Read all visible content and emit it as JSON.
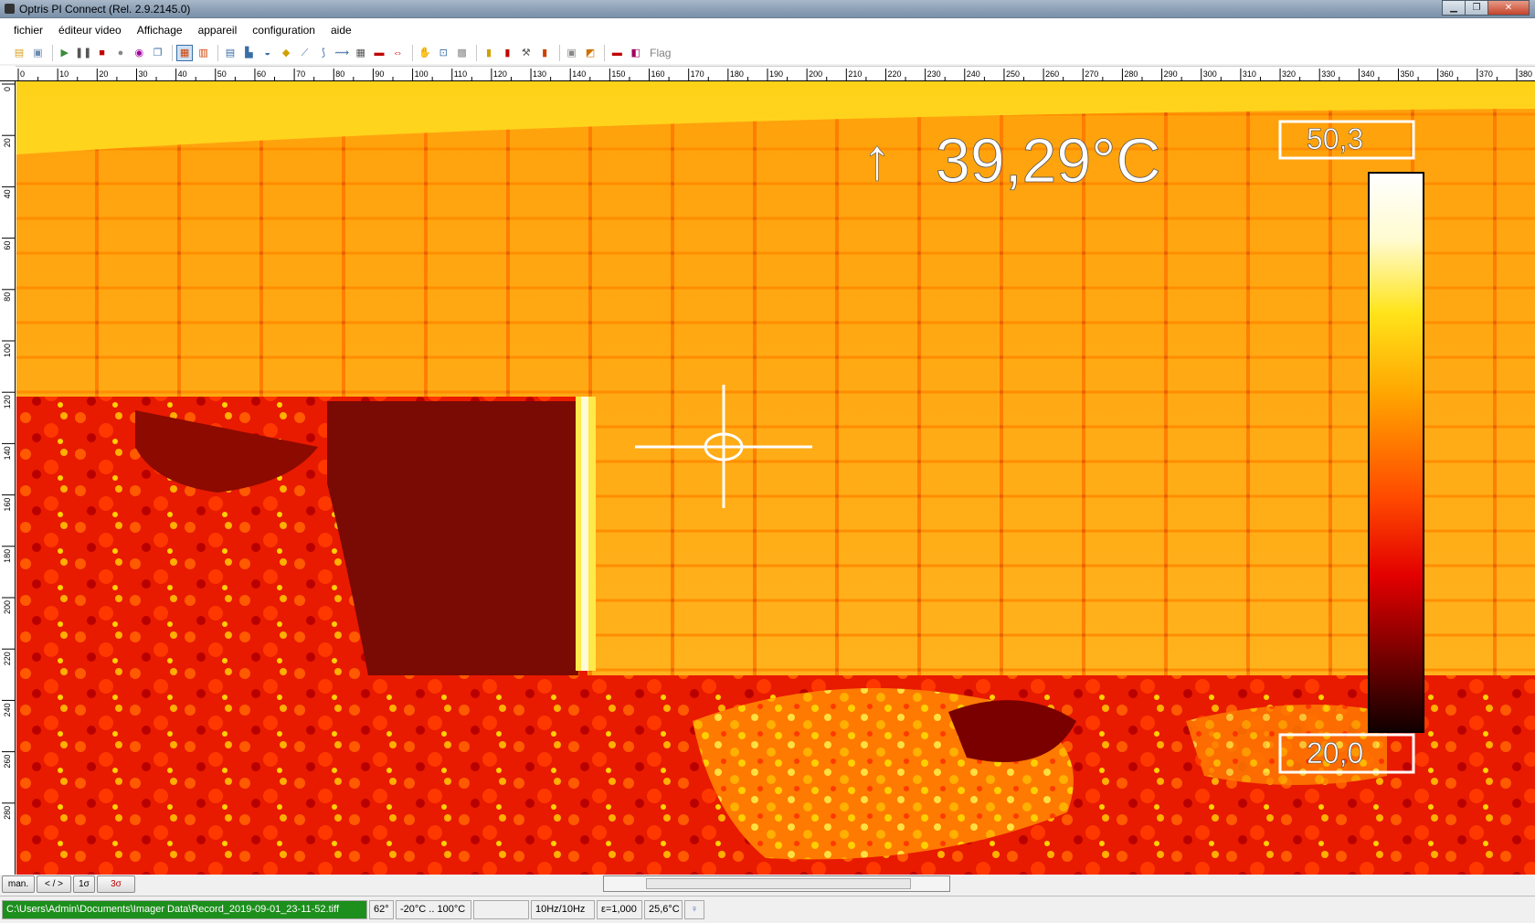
{
  "window": {
    "title": "Optris PI Connect (Rel. 2.9.2145.0)"
  },
  "menu": [
    "fichier",
    "éditeur video",
    "Affichage",
    "appareil",
    "configuration",
    "aide"
  ],
  "toolbar": {
    "flag_label": "Flag",
    "icons": [
      "open-icon",
      "save-icon",
      "play-icon",
      "pause-icon",
      "stop-icon",
      "record-icon",
      "camera-icon",
      "copy-icon",
      "palette-view-icon",
      "split-view-icon",
      "layout-icon",
      "histogram-icon",
      "chart-icon",
      "gauge-icon",
      "line-profile-icon",
      "graph-icon",
      "graph2-icon",
      "grid-icon",
      "measure-line-icon",
      "measure-range-icon",
      "hand-icon",
      "zoom-fit-icon",
      "area-icon",
      "flag-de-icon",
      "flag-fr-icon",
      "tools-icon",
      "hot-spot-icon",
      "cold-spot-icon",
      "hazard-icon",
      "record-red-icon",
      "trigger-icon"
    ]
  },
  "ruler": {
    "x_ticks": [
      "0",
      "10",
      "20",
      "30",
      "40",
      "50",
      "60",
      "70",
      "80",
      "90",
      "100",
      "110",
      "120",
      "130",
      "140",
      "150",
      "160",
      "170",
      "180",
      "190",
      "200",
      "210",
      "220",
      "230",
      "240",
      "250",
      "260",
      "270",
      "280",
      "290",
      "300",
      "310",
      "320",
      "330",
      "340",
      "350",
      "360",
      "370",
      "380"
    ],
    "y_ticks": [
      "0",
      "20",
      "40",
      "60",
      "80",
      "100",
      "120",
      "140",
      "160",
      "180",
      "200",
      "220",
      "240",
      "260",
      "280"
    ]
  },
  "measurement": {
    "arrow": "↑",
    "value": "39,29°C"
  },
  "scale": {
    "max": "50,3",
    "min": "20,0"
  },
  "scale_buttons": [
    "man.",
    "< / >",
    "1σ",
    "3σ"
  ],
  "status": {
    "path": "C:\\Users\\Admin\\Documents\\Imager Data\\Record_2019-09-01_23-11-52.tiff",
    "fov": "62°",
    "range": "-20°C .. 100°C",
    "empty": "",
    "rate": "10Hz/10Hz",
    "emissivity": "ε=1,000",
    "ambient": "25,6°C"
  },
  "colors": {
    "path_bg": "#1c8f1c",
    "accent": "#3a6ea5"
  }
}
